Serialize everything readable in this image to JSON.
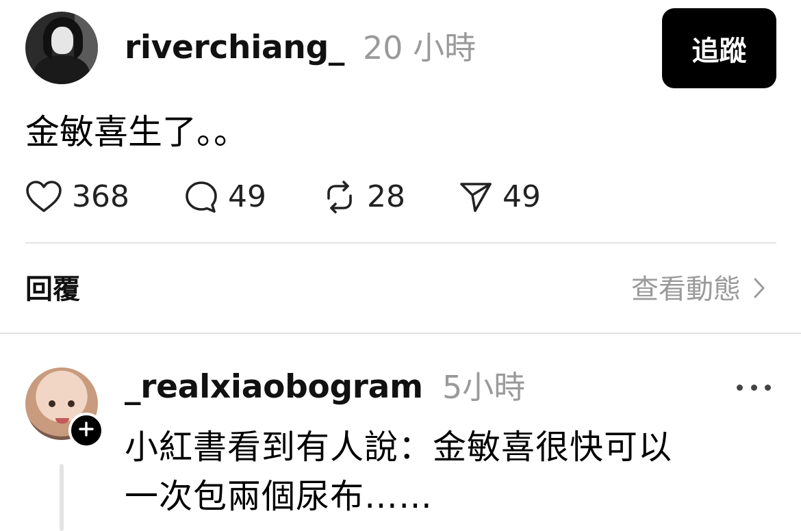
{
  "post": {
    "username": "riverchiang_",
    "time": "20 小時",
    "follow_label": "追蹤",
    "text": "金敏喜生了。。",
    "likes": "368",
    "comments": "49",
    "reposts": "28",
    "shares": "49"
  },
  "replies_section": {
    "label": "回覆",
    "view_activity": "查看動態"
  },
  "reply": {
    "username": "_realxiaobogram",
    "time": "5小時",
    "text_line1": "小紅書看到有人說：金敏喜很快可以",
    "text_line2": "一次包兩個尿布……"
  },
  "icons": {
    "like": "heart-icon",
    "comment": "comment-bubble-icon",
    "repost": "repost-icon",
    "share": "send-icon",
    "chevron": "chevron-right-icon",
    "plus": "plus-icon",
    "more": "more-dots-icon"
  }
}
